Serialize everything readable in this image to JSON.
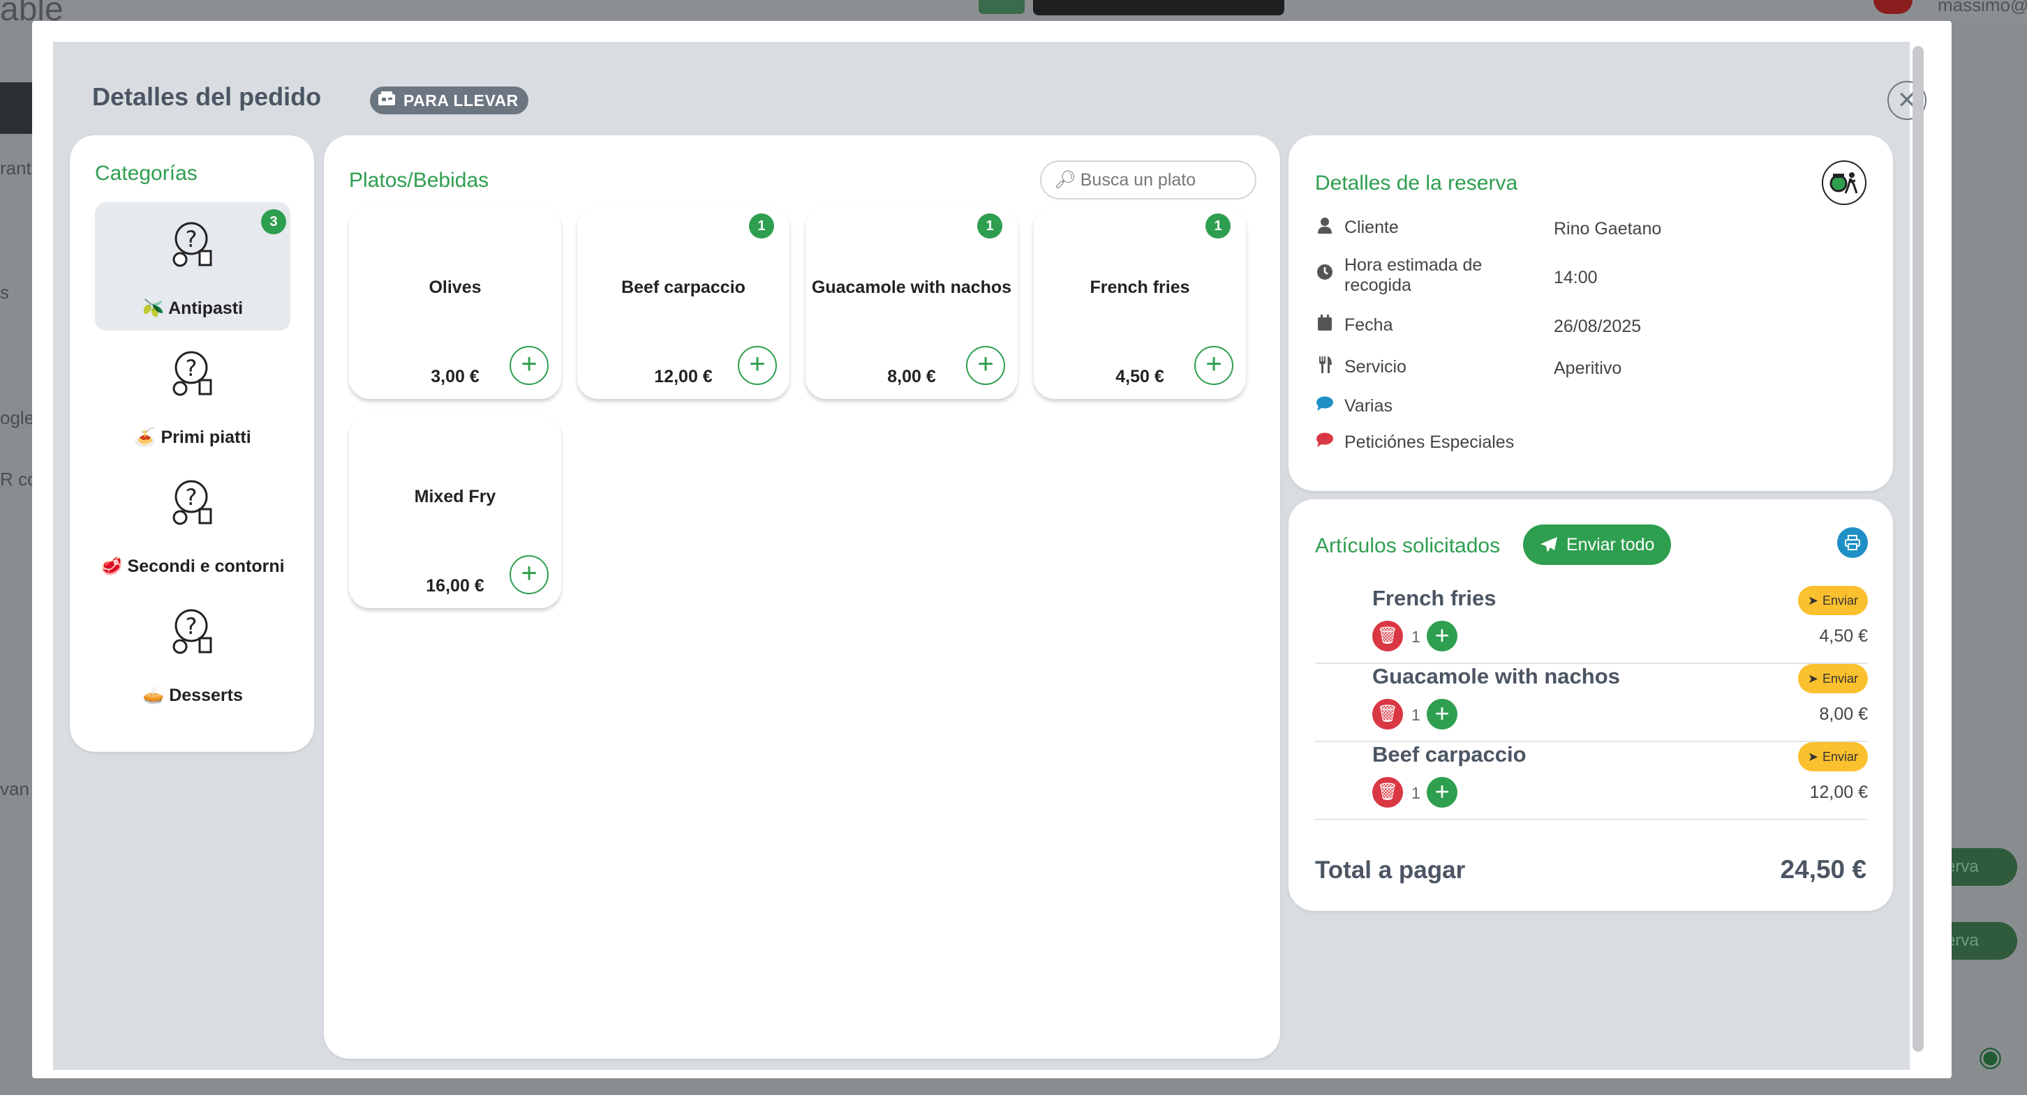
{
  "background": {
    "brand": "able",
    "user": "massimo@",
    "side_texts": [
      "rant",
      "s",
      "ogle",
      "R co",
      "van"
    ],
    "pill_label": "erva"
  },
  "modal": {
    "title": "Detalles del pedido",
    "badge": "PARA LLEVAR",
    "close_icon": "close-icon"
  },
  "categories": {
    "title": "Categorías",
    "items": [
      {
        "emoji": "🫒",
        "label": "Antipasti",
        "count": "3"
      },
      {
        "emoji": "🍝",
        "label": "Primi piatti",
        "count": ""
      },
      {
        "emoji": "🥩",
        "label": "Secondi e contorni",
        "count": ""
      },
      {
        "emoji": "🥧",
        "label": "Desserts",
        "count": ""
      }
    ]
  },
  "dishes": {
    "title": "Platos/Bebidas",
    "search_placeholder": "Busca un plato",
    "items": [
      {
        "name": "Olives",
        "price": "3,00 €",
        "count": ""
      },
      {
        "name": "Beef carpaccio",
        "price": "12,00 €",
        "count": "1"
      },
      {
        "name": "Guacamole with nachos",
        "price": "8,00 €",
        "count": "1"
      },
      {
        "name": "French fries",
        "price": "4,50 €",
        "count": "1"
      },
      {
        "name": "Mixed Fry",
        "price": "16,00 €",
        "count": ""
      }
    ]
  },
  "reservation": {
    "title": "Detalles de la reserva",
    "rows": [
      {
        "icon": "user-icon",
        "label": "Cliente",
        "value": "Rino Gaetano"
      },
      {
        "icon": "clock-icon",
        "label": "Hora estimada de recogida",
        "value": "14:00"
      },
      {
        "icon": "calendar-icon",
        "label": "Fecha",
        "value": "26/08/2025"
      },
      {
        "icon": "cutlery-icon",
        "label": "Servicio",
        "value": "Aperitivo"
      },
      {
        "icon": "comment-icon",
        "label": "Varias",
        "value": ""
      },
      {
        "icon": "comment-icon",
        "label": "Peticiónes Especiales",
        "value": ""
      }
    ]
  },
  "ordered": {
    "title": "Artículos solicitados",
    "send_all": "Enviar todo",
    "send_label": "Enviar",
    "items": [
      {
        "name": "French fries",
        "qty": "1",
        "price": "4,50 €"
      },
      {
        "name": "Guacamole with nachos",
        "qty": "1",
        "price": "8,00 €"
      },
      {
        "name": "Beef carpaccio",
        "qty": "1",
        "price": "12,00 €"
      }
    ],
    "total_label": "Total a pagar",
    "total_value": "24,50 €"
  },
  "colors": {
    "accent_green": "#2e9e4f",
    "delete_red": "#d93743",
    "send_yellow": "#fbc02d",
    "print_blue": "#1e90c6"
  }
}
